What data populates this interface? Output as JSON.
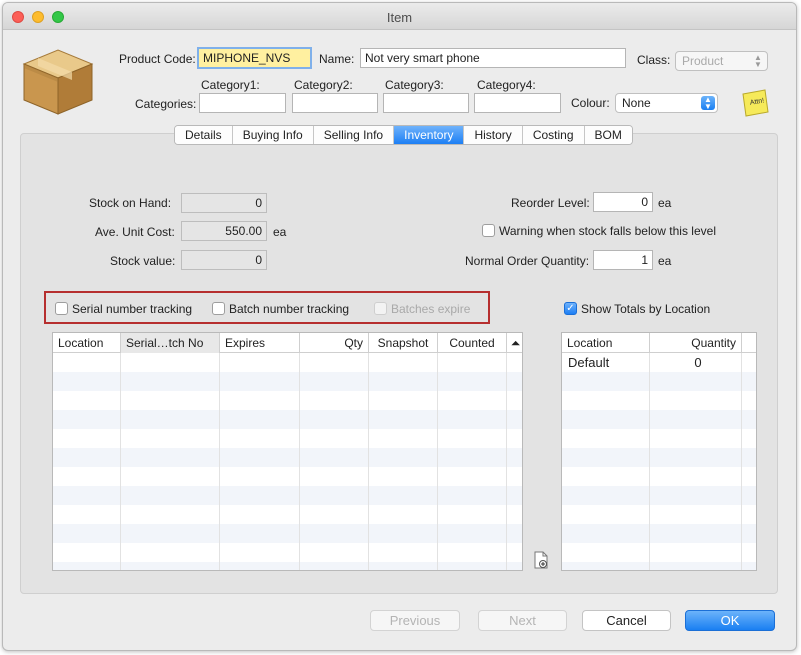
{
  "window": {
    "title": "Item"
  },
  "header": {
    "product_code_label": "Product Code:",
    "product_code_value": "MIPHONE_NVS",
    "name_label": "Name:",
    "name_value": "Not very smart phone",
    "class_label": "Class:",
    "class_value": "Product",
    "categories_label": "Categories:",
    "category1_label": "Category1:",
    "category2_label": "Category2:",
    "category3_label": "Category3:",
    "category4_label": "Category4:",
    "category1_value": "",
    "category2_value": "",
    "category3_value": "",
    "category4_value": "",
    "colour_label": "Colour:",
    "colour_value": "None",
    "note_icon_text": "Attn!"
  },
  "tabs": [
    {
      "label": "Details",
      "active": false
    },
    {
      "label": "Buying Info",
      "active": false
    },
    {
      "label": "Selling Info",
      "active": false
    },
    {
      "label": "Inventory",
      "active": true
    },
    {
      "label": "History",
      "active": false
    },
    {
      "label": "Costing",
      "active": false
    },
    {
      "label": "BOM",
      "active": false
    }
  ],
  "inventory": {
    "stock_on_hand_label": "Stock on Hand:",
    "stock_on_hand_value": "0",
    "avg_unit_cost_label": "Ave. Unit Cost:",
    "avg_unit_cost_value": "550.00",
    "avg_unit_cost_unit": "ea",
    "stock_value_label": "Stock value:",
    "stock_value_value": "0",
    "reorder_level_label": "Reorder Level:",
    "reorder_level_value": "0",
    "reorder_level_unit": "ea",
    "warning_label": "Warning when stock falls below this level",
    "warning_checked": false,
    "normal_order_qty_label": "Normal Order Quantity:",
    "normal_order_qty_value": "1",
    "normal_order_qty_unit": "ea",
    "serial_tracking_label": "Serial number tracking",
    "batch_tracking_label": "Batch number tracking",
    "batches_expire_label": "Batches expire",
    "show_totals_label": "Show Totals by Location",
    "show_totals_checked": true
  },
  "batch_table": {
    "columns": [
      "Location",
      "Serial…tch No",
      "Expires",
      "Qty",
      "Snapshot",
      "Counted"
    ],
    "sort_icon": "sort-up-icon",
    "rows": []
  },
  "location_table": {
    "columns": [
      "Location",
      "Quantity"
    ],
    "rows": [
      {
        "location": "Default",
        "quantity": "0"
      }
    ]
  },
  "buttons": {
    "previous": "Previous",
    "next": "Next",
    "cancel": "Cancel",
    "ok": "OK"
  },
  "colors": {
    "accent": "#1d7ff4",
    "highlight_field": "#fff0a0",
    "red_outline": "#b62f2f"
  }
}
